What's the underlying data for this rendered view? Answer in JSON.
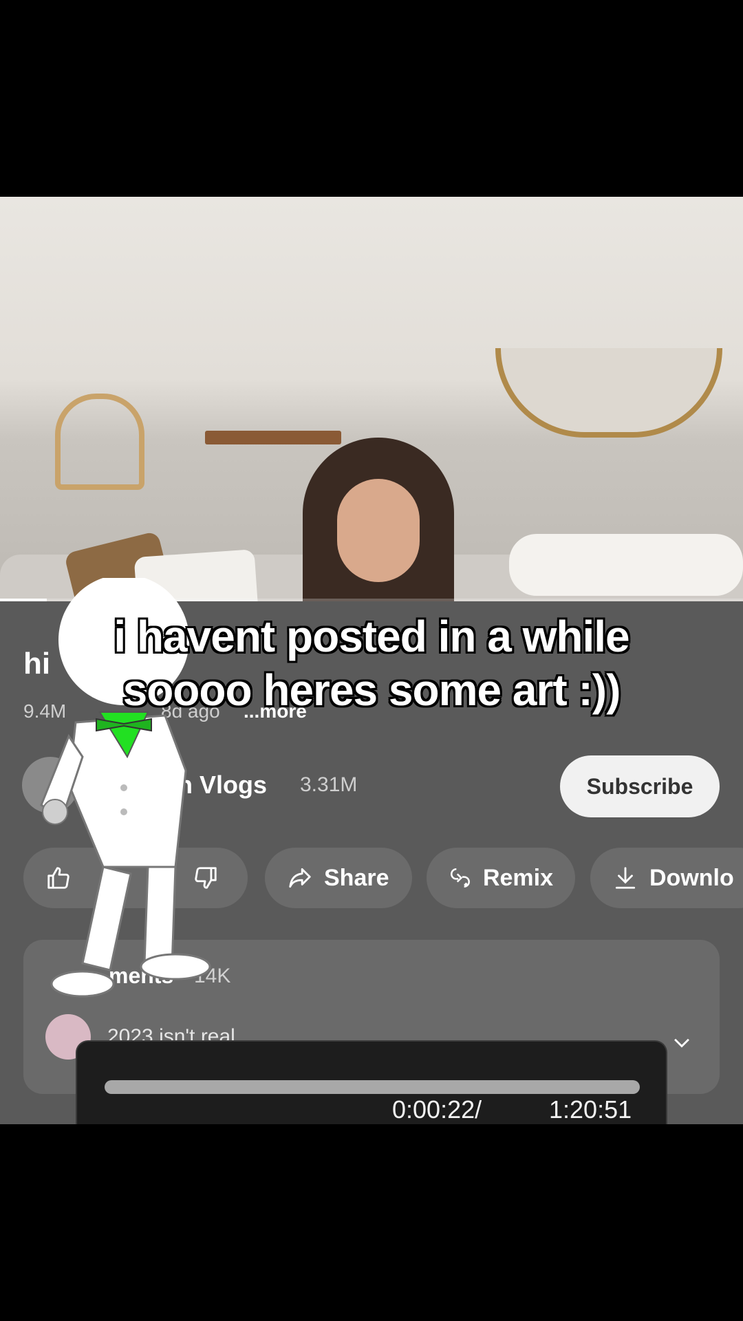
{
  "video": {
    "progress_fraction": 0.063
  },
  "info": {
    "title": "hi",
    "views": "9.4M",
    "age": "8d ago",
    "more_label": "...more"
  },
  "channel": {
    "name": "en Vlogs",
    "subscribers": "3.31M",
    "subscribe_label": "Subscribe"
  },
  "actions": {
    "like_icon": "thumbs-up-icon",
    "dislike_icon": "thumbs-down-icon",
    "share_label": "Share",
    "remix_label": "Remix",
    "download_label": "Downlo"
  },
  "comments": {
    "label": "ments",
    "count": "14K",
    "top_comment": "2023 isn't real"
  },
  "scrubber": {
    "current_time": "0:00:22/",
    "total_time": "1:20:51"
  },
  "caption": {
    "line1": "i havent posted in a while",
    "line2": "soooo heres some art :))"
  },
  "colors": {
    "panel": "#5a5a5a",
    "chip": "#6b6b6b",
    "subscribe": "#f1f1f1",
    "bow": "#22e022"
  }
}
